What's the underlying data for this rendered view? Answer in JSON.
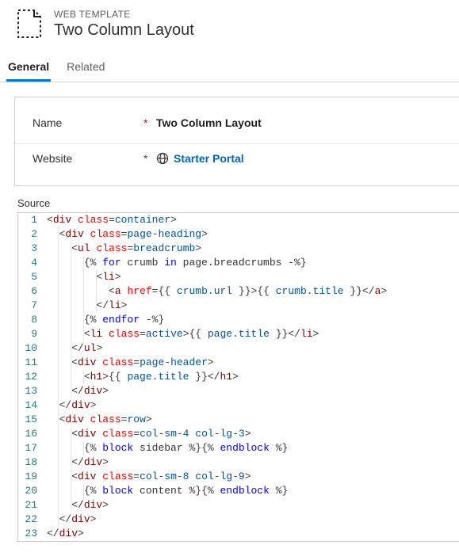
{
  "header": {
    "eyebrow": "WEB TEMPLATE",
    "title": "Two Column Layout"
  },
  "tabs": [
    {
      "label": "General",
      "active": true
    },
    {
      "label": "Related",
      "active": false
    }
  ],
  "form": {
    "name_label": "Name",
    "name_value": "Two Column Layout",
    "website_label": "Website",
    "website_value": "Starter Portal",
    "required_marker": "*"
  },
  "source": {
    "label": "Source",
    "lines": [
      {
        "n": 1,
        "indent": 0,
        "tokens": [
          [
            "<",
            "delim"
          ],
          [
            "div",
            "tag"
          ],
          [
            " ",
            "text"
          ],
          [
            "class",
            "attr"
          ],
          [
            "=",
            "delim"
          ],
          [
            "container",
            "val"
          ],
          [
            ">",
            "delim"
          ]
        ]
      },
      {
        "n": 2,
        "indent": 1,
        "tokens": [
          [
            "<",
            "delim"
          ],
          [
            "div",
            "tag"
          ],
          [
            " ",
            "text"
          ],
          [
            "class",
            "attr"
          ],
          [
            "=",
            "delim"
          ],
          [
            "page-heading",
            "val"
          ],
          [
            ">",
            "delim"
          ]
        ]
      },
      {
        "n": 3,
        "indent": 2,
        "tokens": [
          [
            "<",
            "delim"
          ],
          [
            "ul",
            "tag"
          ],
          [
            " ",
            "text"
          ],
          [
            "class",
            "attr"
          ],
          [
            "=",
            "delim"
          ],
          [
            "breadcrumb",
            "val"
          ],
          [
            ">",
            "delim"
          ]
        ]
      },
      {
        "n": 4,
        "indent": 3,
        "tokens": [
          [
            "{% ",
            "brace"
          ],
          [
            "for",
            "liq"
          ],
          [
            " crumb ",
            "text"
          ],
          [
            "in",
            "liq"
          ],
          [
            " page.breadcrumbs -",
            "text"
          ],
          [
            "%}",
            "brace"
          ]
        ]
      },
      {
        "n": 5,
        "indent": 4,
        "tokens": [
          [
            "<",
            "delim"
          ],
          [
            "li",
            "tag"
          ],
          [
            ">",
            "delim"
          ]
        ]
      },
      {
        "n": 6,
        "indent": 5,
        "tokens": [
          [
            "<",
            "delim"
          ],
          [
            "a",
            "tag"
          ],
          [
            " ",
            "text"
          ],
          [
            "href",
            "attr"
          ],
          [
            "=",
            "delim"
          ],
          [
            "{{ ",
            "brace"
          ],
          [
            "crumb.url",
            "val"
          ],
          [
            " }}",
            "brace"
          ],
          [
            ">",
            "delim"
          ],
          [
            "{{ ",
            "brace"
          ],
          [
            "crumb.title",
            "val"
          ],
          [
            " }}",
            "brace"
          ],
          [
            "</",
            "delim"
          ],
          [
            "a",
            "tag"
          ],
          [
            ">",
            "delim"
          ]
        ]
      },
      {
        "n": 7,
        "indent": 4,
        "tokens": [
          [
            "</",
            "delim"
          ],
          [
            "li",
            "tag"
          ],
          [
            ">",
            "delim"
          ]
        ]
      },
      {
        "n": 8,
        "indent": 3,
        "tokens": [
          [
            "{% ",
            "brace"
          ],
          [
            "endfor",
            "liq"
          ],
          [
            " -",
            "text"
          ],
          [
            "%}",
            "brace"
          ]
        ]
      },
      {
        "n": 9,
        "indent": 3,
        "tokens": [
          [
            "<",
            "delim"
          ],
          [
            "li",
            "tag"
          ],
          [
            " ",
            "text"
          ],
          [
            "class",
            "attr"
          ],
          [
            "=",
            "delim"
          ],
          [
            "active",
            "val"
          ],
          [
            ">",
            "delim"
          ],
          [
            "{{ ",
            "brace"
          ],
          [
            "page.title",
            "val"
          ],
          [
            " }}",
            "brace"
          ],
          [
            "</",
            "delim"
          ],
          [
            "li",
            "tag"
          ],
          [
            ">",
            "delim"
          ]
        ]
      },
      {
        "n": 10,
        "indent": 2,
        "tokens": [
          [
            "</",
            "delim"
          ],
          [
            "ul",
            "tag"
          ],
          [
            ">",
            "delim"
          ]
        ]
      },
      {
        "n": 11,
        "indent": 2,
        "tokens": [
          [
            "<",
            "delim"
          ],
          [
            "div",
            "tag"
          ],
          [
            " ",
            "text"
          ],
          [
            "class",
            "attr"
          ],
          [
            "=",
            "delim"
          ],
          [
            "page-header",
            "val"
          ],
          [
            ">",
            "delim"
          ]
        ]
      },
      {
        "n": 12,
        "indent": 3,
        "tokens": [
          [
            "<",
            "delim"
          ],
          [
            "h1",
            "tag"
          ],
          [
            ">",
            "delim"
          ],
          [
            "{{ ",
            "brace"
          ],
          [
            "page.title",
            "val"
          ],
          [
            " }}",
            "brace"
          ],
          [
            "</",
            "delim"
          ],
          [
            "h1",
            "tag"
          ],
          [
            ">",
            "delim"
          ]
        ]
      },
      {
        "n": 13,
        "indent": 2,
        "tokens": [
          [
            "</",
            "delim"
          ],
          [
            "div",
            "tag"
          ],
          [
            ">",
            "delim"
          ]
        ]
      },
      {
        "n": 14,
        "indent": 1,
        "tokens": [
          [
            "</",
            "delim"
          ],
          [
            "div",
            "tag"
          ],
          [
            ">",
            "delim"
          ]
        ]
      },
      {
        "n": 15,
        "indent": 1,
        "tokens": [
          [
            "<",
            "delim"
          ],
          [
            "div",
            "tag"
          ],
          [
            " ",
            "text"
          ],
          [
            "class",
            "attr"
          ],
          [
            "=",
            "delim"
          ],
          [
            "row",
            "val"
          ],
          [
            ">",
            "delim"
          ]
        ]
      },
      {
        "n": 16,
        "indent": 2,
        "tokens": [
          [
            "<",
            "delim"
          ],
          [
            "div",
            "tag"
          ],
          [
            " ",
            "text"
          ],
          [
            "class",
            "attr"
          ],
          [
            "=",
            "delim"
          ],
          [
            "col-sm-4 col-lg-3",
            "val"
          ],
          [
            ">",
            "delim"
          ]
        ]
      },
      {
        "n": 17,
        "indent": 3,
        "tokens": [
          [
            "{% ",
            "brace"
          ],
          [
            "block",
            "liq"
          ],
          [
            " sidebar ",
            "text"
          ],
          [
            "%}",
            "brace"
          ],
          [
            "{% ",
            "brace"
          ],
          [
            "endblock",
            "liq"
          ],
          [
            " ",
            "text"
          ],
          [
            "%}",
            "brace"
          ]
        ]
      },
      {
        "n": 18,
        "indent": 2,
        "tokens": [
          [
            "</",
            "delim"
          ],
          [
            "div",
            "tag"
          ],
          [
            ">",
            "delim"
          ]
        ]
      },
      {
        "n": 19,
        "indent": 2,
        "tokens": [
          [
            "<",
            "delim"
          ],
          [
            "div",
            "tag"
          ],
          [
            " ",
            "text"
          ],
          [
            "class",
            "attr"
          ],
          [
            "=",
            "delim"
          ],
          [
            "col-sm-8 col-lg-9",
            "val"
          ],
          [
            ">",
            "delim"
          ]
        ]
      },
      {
        "n": 20,
        "indent": 3,
        "tokens": [
          [
            "{% ",
            "brace"
          ],
          [
            "block",
            "liq"
          ],
          [
            " content ",
            "text"
          ],
          [
            "%}",
            "brace"
          ],
          [
            "{% ",
            "brace"
          ],
          [
            "endblock",
            "liq"
          ],
          [
            " ",
            "text"
          ],
          [
            "%}",
            "brace"
          ]
        ]
      },
      {
        "n": 21,
        "indent": 2,
        "tokens": [
          [
            "</",
            "delim"
          ],
          [
            "div",
            "tag"
          ],
          [
            ">",
            "delim"
          ]
        ]
      },
      {
        "n": 22,
        "indent": 1,
        "tokens": [
          [
            "</",
            "delim"
          ],
          [
            "div",
            "tag"
          ],
          [
            ">",
            "delim"
          ]
        ]
      },
      {
        "n": 23,
        "indent": 0,
        "tokens": [
          [
            "</",
            "delim"
          ],
          [
            "div",
            "tag"
          ],
          [
            ">",
            "delim"
          ]
        ]
      }
    ]
  }
}
